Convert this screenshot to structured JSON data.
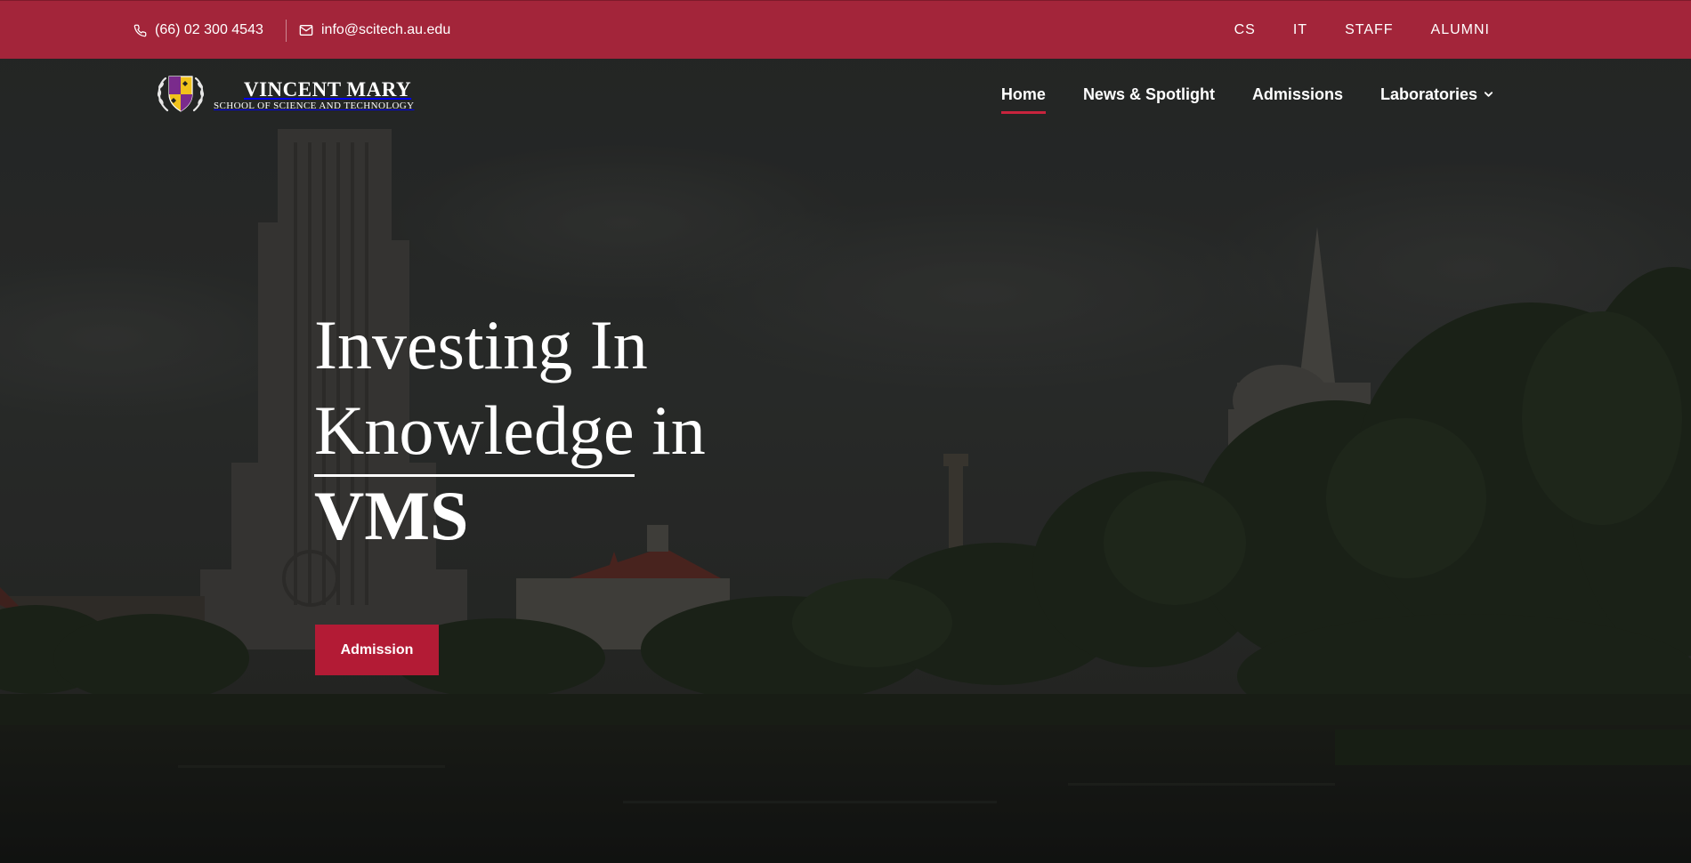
{
  "topbar": {
    "phone": "(66) 02 300 4543",
    "email": "info@scitech.au.edu",
    "phone_icon": "phone-icon",
    "email_icon": "envelope-icon",
    "quick_links": [
      "CS",
      "IT",
      "STAFF",
      "ALUMNI"
    ],
    "background_color": "#a3253a"
  },
  "logo": {
    "title": "VINCENT MARY",
    "subtitle": "SCHOOL OF SCIENCE AND TECHNOLOGY",
    "emblem_icon": "crest-icon"
  },
  "nav": {
    "items": [
      {
        "label": "Home",
        "active": true
      },
      {
        "label": "News & Spotlight",
        "active": false
      },
      {
        "label": "Admissions",
        "active": false
      },
      {
        "label": "Laboratories",
        "active": false,
        "dropdown_icon": "chevron-down-icon"
      }
    ],
    "active_underline_color": "#c8243d"
  },
  "hero": {
    "line1": "Investing In",
    "line2_underlined": "Knowledge",
    "line2_rest": " in",
    "line3": "VMS",
    "button_label": "Admission",
    "button_color": "#b31b35"
  }
}
